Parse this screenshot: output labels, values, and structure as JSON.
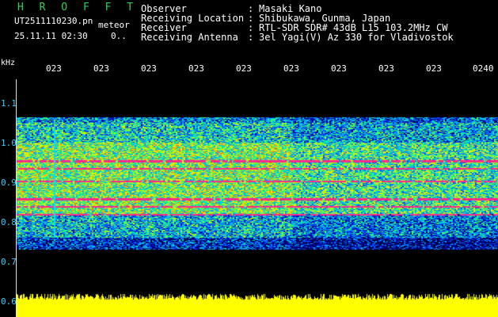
{
  "station": {
    "title": "H R O F F T",
    "filename": "UT2511110230.pn",
    "mode": "meteor",
    "datetime": "25.11.11 02:30",
    "count": "0.."
  },
  "header": {
    "rows": [
      {
        "label": "Observer",
        "value": "Masaki Kano"
      },
      {
        "label": "Receiving Location",
        "value": "Shibukawa, Gunma, Japan"
      },
      {
        "label": "Receiver",
        "value": "RTL-SDR SDR# 43dB L15 103.2MHz CW"
      },
      {
        "label": "Receiving Antenna",
        "value": "3el Yagi(V) Az 330 for Vladivostok"
      }
    ],
    "colon": ":"
  },
  "axes": {
    "y_unit": "kHz",
    "y_ticks": [
      "1.1",
      "1.0",
      "0.9",
      "0.8",
      "0.7",
      "0.6"
    ],
    "x_ticks": [
      "023",
      "023",
      "023",
      "023",
      "023",
      "023",
      "023",
      "023",
      "023",
      "0240"
    ]
  },
  "colors": {
    "background": "#000000",
    "station_text": "#35d05a",
    "header_text": "#ffffff",
    "axis_text": "#34d0ff",
    "signal_peak": "#ff2a8a",
    "noise_band": "#ffff00"
  }
}
